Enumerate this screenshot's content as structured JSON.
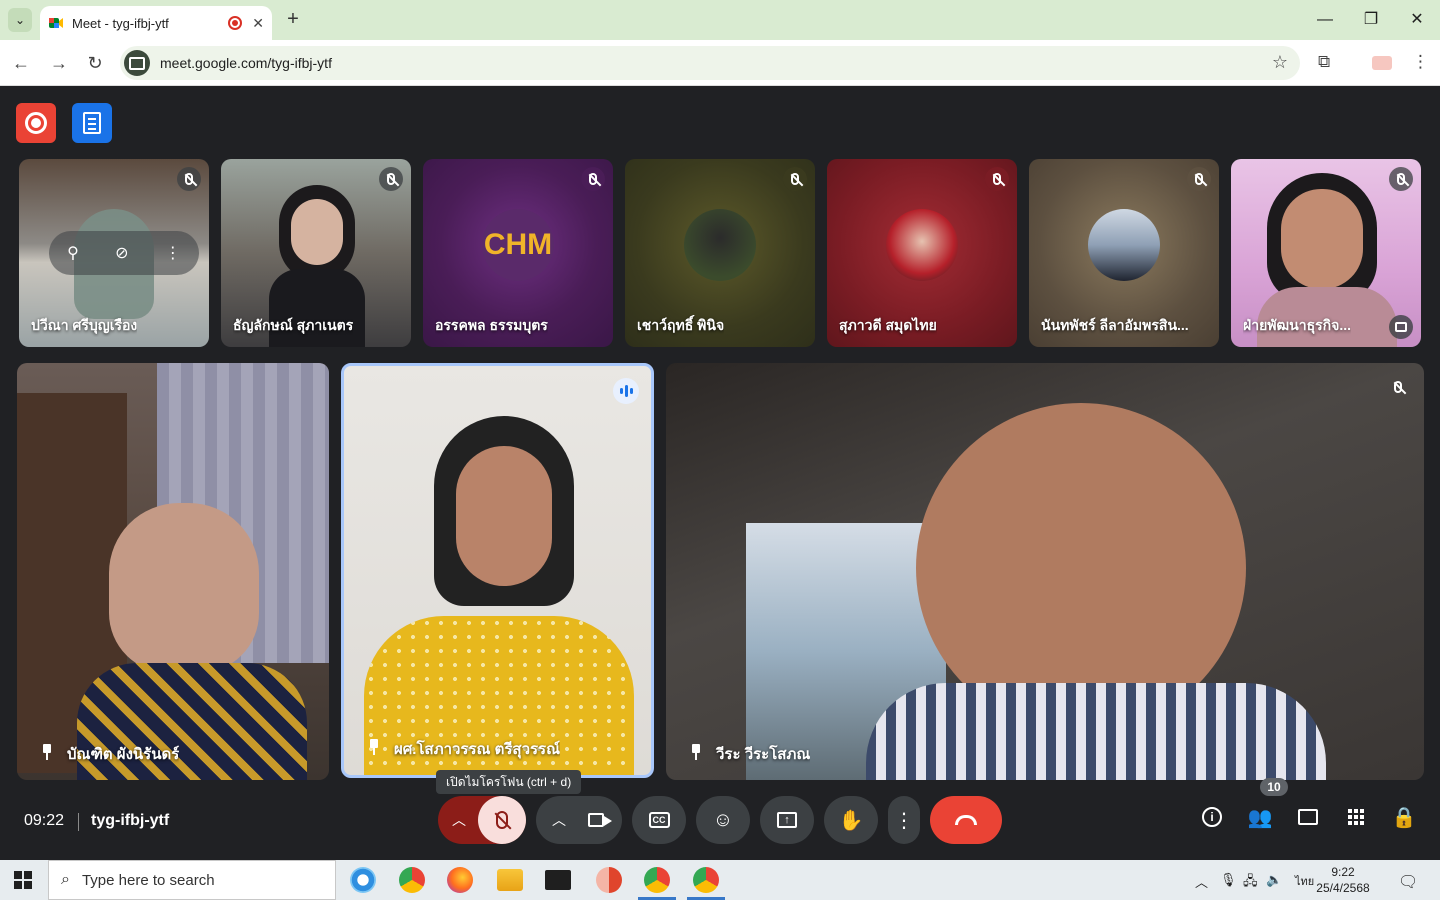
{
  "browser": {
    "tab_title": "Meet - tyg-ifbj-ytf",
    "url": "meet.google.com/tyg-ifbj-ytf"
  },
  "meeting": {
    "time": "09:22",
    "code": "tyg-ifbj-ytf",
    "participant_count": "10",
    "mic_tooltip": "เปิดไมโครโฟน (ctrl + d)"
  },
  "tiles_small": [
    {
      "name": "ปวีณา ศรีบุญเรือง"
    },
    {
      "name": "ธัญลักษณ์ สุภาเนตร"
    },
    {
      "name": "อรรคพล ธรรมบุตร"
    },
    {
      "name": "เชาว์ฤทธิ์ พินิจ"
    },
    {
      "name": "สุภาวดี สมุดไทย"
    },
    {
      "name": "นันทพัชร์ ลีลาอัมพรสิน..."
    },
    {
      "name": "ฝ่ายพัฒนาธุรกิจ..."
    }
  ],
  "tiles_big": [
    {
      "name": "บัณฑิต ผังนิรันดร์"
    },
    {
      "name": "ผศ.โสภาวรรณ ตรีสุวรรณ์"
    },
    {
      "name": "วีระ วีระโสภณ"
    }
  ],
  "avatar_logo_text": "CHM",
  "taskbar": {
    "search_placeholder": "Type here to search",
    "lang": "ไทย",
    "time": "9:22",
    "date": "25/4/2568"
  },
  "colors": {
    "record": "#ea4335",
    "notes": "#1a73e8",
    "leave": "#ea4335",
    "speaking_border": "#a8c7fa"
  }
}
